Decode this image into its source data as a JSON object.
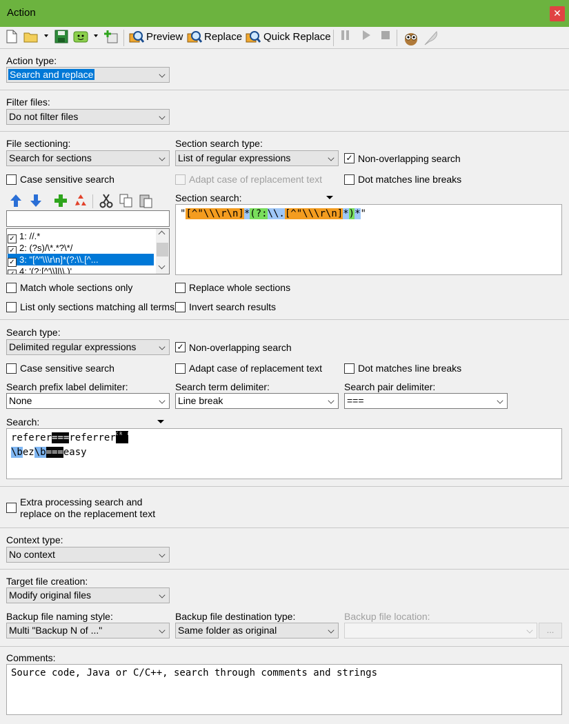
{
  "window": {
    "title": "Action",
    "close_glyph": "✕"
  },
  "toolbar": {
    "preview_label": "Preview",
    "replace_label": "Replace",
    "quick_replace_label": "Quick Replace"
  },
  "action_type": {
    "label": "Action type:",
    "value": "Search and replace"
  },
  "filter_files": {
    "label": "Filter files:",
    "value": "Do not filter files"
  },
  "sectioning": {
    "label": "File sectioning:",
    "value": "Search for sections",
    "section_search_type_label": "Section search type:",
    "section_search_type_value": "List of regular expressions",
    "non_overlapping_label": "Non-overlapping search",
    "non_overlapping_checked": true,
    "case_sensitive_label": "Case sensitive search",
    "adapt_case_label": "Adapt case of replacement text",
    "dot_matches_label": "Dot matches line breaks",
    "section_search_label": "Section search:",
    "section_search_text": "\"[^\"\\\\\\r\\n]*(?:\\\\.[^\"\\\\\\r\\n]*)*\"",
    "list_items": [
      {
        "label": "1: //.*",
        "checked": true
      },
      {
        "label": "2: (?s)/\\*.*?\\*/",
        "checked": true
      },
      {
        "label": "3: \"[^\"\\\\\\r\\n]*(?:\\\\.[^...",
        "checked": true,
        "selected": true
      },
      {
        "label": "4: '(?:[^'\\\\]|\\\\.)'",
        "checked": true
      }
    ],
    "match_whole_label": "Match whole sections only",
    "list_only_label": "List only sections matching all terms",
    "replace_whole_label": "Replace whole sections",
    "invert_label": "Invert search results"
  },
  "search": {
    "type_label": "Search type:",
    "type_value": "Delimited regular expressions",
    "non_overlapping_label": "Non-overlapping search",
    "non_overlapping_checked": true,
    "case_sensitive_label": "Case sensitive search",
    "adapt_case_label": "Adapt case of replacement text",
    "dot_matches_label": "Dot matches line breaks",
    "prefix_label": "Search prefix label delimiter:",
    "prefix_value": "None",
    "term_label": "Search term delimiter:",
    "term_value": "Line break",
    "pair_label": "Search pair delimiter:",
    "pair_value": "===",
    "search_label": "Search:",
    "line1_a": "referer",
    "line1_delim": "===",
    "line1_b": "referrer",
    "crlf_glyph": "CR LF",
    "line2_a": "\\b",
    "line2_b": "ez",
    "line2_c": "\\b",
    "line2_delim": "===",
    "line2_d": "easy"
  },
  "extra": {
    "label_line1": "Extra processing search and",
    "label_line2": "replace on the replacement text"
  },
  "context": {
    "label": "Context type:",
    "value": "No context"
  },
  "target": {
    "label": "Target file creation:",
    "value": "Modify original files",
    "backup_naming_label": "Backup file naming style:",
    "backup_naming_value": "Multi \"Backup N of ...\"",
    "backup_dest_label": "Backup file destination type:",
    "backup_dest_value": "Same folder as original",
    "backup_location_label": "Backup file location:",
    "browse_label": "..."
  },
  "comments": {
    "label": "Comments:",
    "text": "Source code, Java or C/C++, search through comments and strings"
  }
}
